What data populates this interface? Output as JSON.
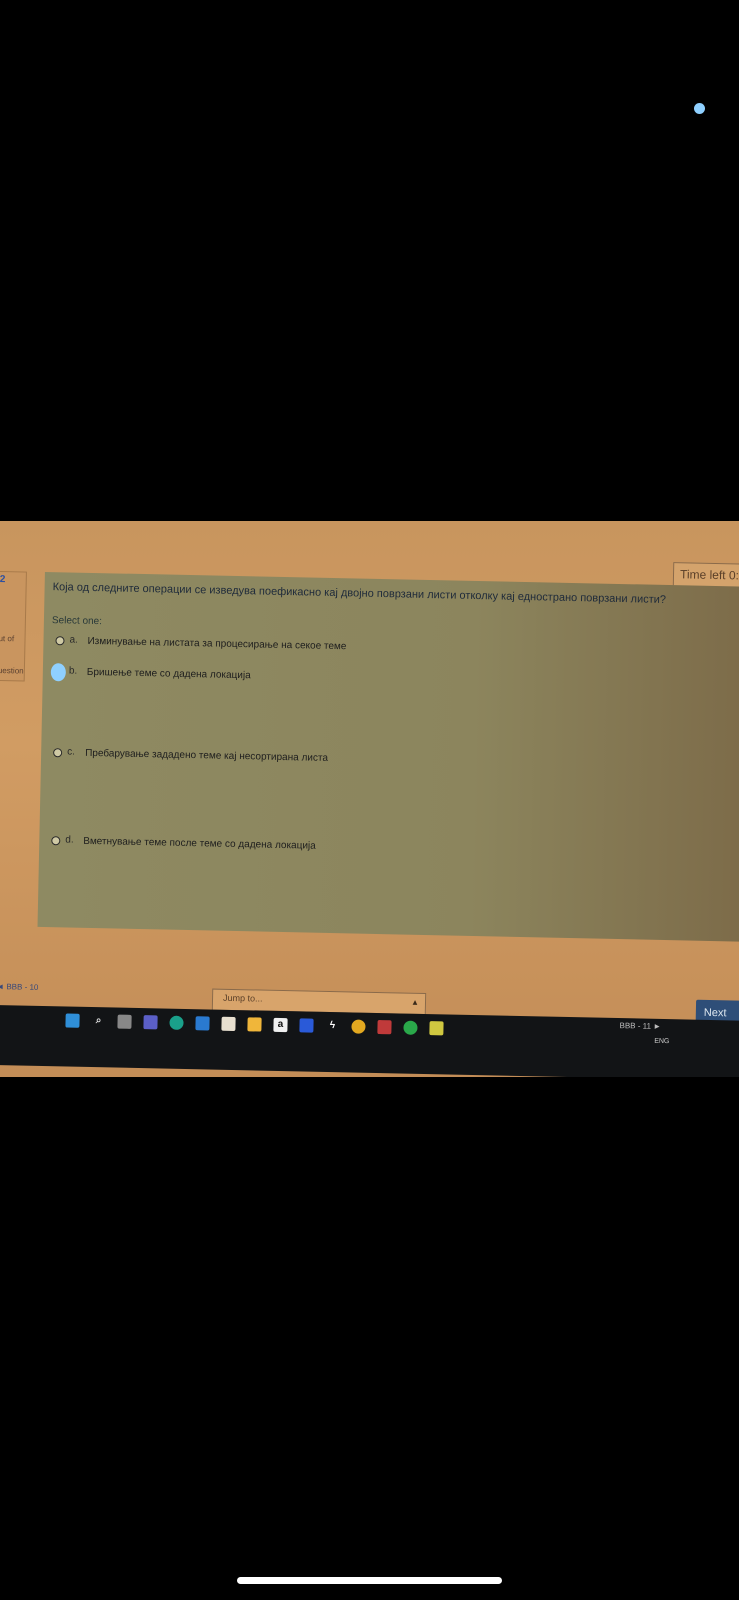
{
  "timer": {
    "label": "Time left 0:"
  },
  "side_panel": {
    "flag": "2",
    "out_of": "ut of",
    "question": "uestion"
  },
  "question": {
    "text": "Која од следните операции се изведува поефикасно кај двојно поврзани листи отколку кај еднострано поврзани листи?",
    "select_one": "Select one:",
    "options": [
      {
        "letter": "a.",
        "text": "Изминување на листата за процесирање на секое теме",
        "selected": false
      },
      {
        "letter": "b.",
        "text": "Бришење теме со дадена локација",
        "selected": true
      },
      {
        "letter": "c.",
        "text": "Пребарување зададено теме кај несортирана листа",
        "selected": false
      },
      {
        "letter": "d.",
        "text": "Вметнување теме после теме со дадена локација",
        "selected": false
      }
    ]
  },
  "navigation": {
    "prev_label": "◄ BBB - 10",
    "jump_placeholder": "Jump to...",
    "next_label": "Next",
    "next_activity": "BBB - 11 ►"
  },
  "taskbar": {
    "icons": [
      "windows-start-icon",
      "search-icon",
      "task-view-icon",
      "teams-icon",
      "edge-icon",
      "mail-icon",
      "store-icon",
      "file-explorer-icon",
      "amazon-icon",
      "dropbox-icon",
      "bolt-icon",
      "chrome-icon",
      "app-icon",
      "media-player-icon",
      "norton-icon"
    ],
    "amazon_glyph": "a",
    "language": "ENG"
  },
  "colors": {
    "accent": "#2e4e78",
    "selection": "#8fd0ff"
  }
}
